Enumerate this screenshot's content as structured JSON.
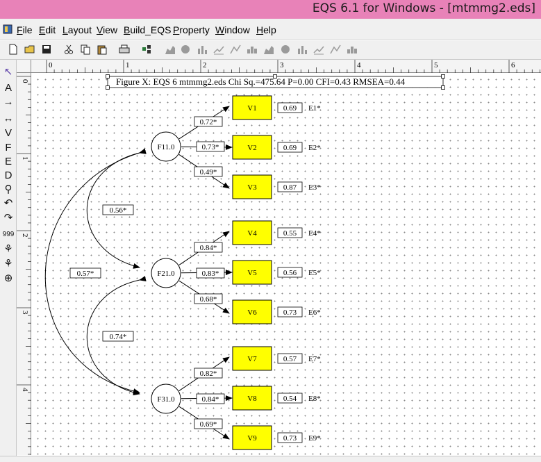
{
  "window": {
    "title": "EQS 6.1 for Windows - [mtmmg2.eds]"
  },
  "menu": [
    {
      "label": "File",
      "accel": "F",
      "rest": "ile"
    },
    {
      "label": "Edit",
      "accel": "E",
      "rest": "dit"
    },
    {
      "label": "Layout",
      "accel": "L",
      "rest": "ayout"
    },
    {
      "label": "View",
      "accel": "V",
      "rest": "iew"
    },
    {
      "label": "Build_EQS",
      "accel": "B",
      "rest": "uild_EQS"
    },
    {
      "label": "Property",
      "accel": "P",
      "rest": "roperty"
    },
    {
      "label": "Window",
      "accel": "W",
      "rest": "indow"
    },
    {
      "label": "Help",
      "accel": "H",
      "rest": "elp"
    }
  ],
  "toolbar": [
    "new-file-icon",
    "open-folder-icon",
    "save-icon",
    "cut-icon",
    "copy-icon",
    "paste-icon",
    "print-icon",
    "diagram-icon",
    "chart-bar-icon",
    "chart-line-icon",
    "chart-area-icon",
    "chart-hist-icon",
    "chart-dot-icon",
    "chart-stack-icon",
    "chart-scatter-icon",
    "chart-line2-icon",
    "chart-line3-icon",
    "chart-3d-icon",
    "chart-box-icon",
    "chart-table-icon"
  ],
  "tools": [
    {
      "name": "pointer-tool",
      "glyph": "↖"
    },
    {
      "name": "text-tool",
      "glyph": "A"
    },
    {
      "name": "one-way-arrow-tool",
      "glyph": "→"
    },
    {
      "name": "two-way-arrow-tool",
      "glyph": "↔"
    },
    {
      "name": "v-tool",
      "glyph": "V"
    },
    {
      "name": "f-tool",
      "glyph": "F"
    },
    {
      "name": "e-tool",
      "glyph": "E"
    },
    {
      "name": "d-tool",
      "glyph": "D"
    },
    {
      "name": "factor-model-tool",
      "glyph": "⚲"
    },
    {
      "name": "curve-left-tool",
      "glyph": "↶"
    },
    {
      "name": "curve-right-tool",
      "glyph": "↷"
    },
    {
      "name": "number-tool",
      "glyph": "999"
    },
    {
      "name": "structure-tool-1",
      "glyph": "⚘"
    },
    {
      "name": "structure-tool-2",
      "glyph": "⚘"
    },
    {
      "name": "crosshair-tool",
      "glyph": "⊕"
    }
  ],
  "ruler": {
    "horizontal": [
      "0",
      "1",
      "2",
      "3",
      "4",
      "5",
      "6"
    ],
    "vertical": [
      "0",
      "1",
      "2",
      "3",
      "4"
    ]
  },
  "diagram": {
    "caption": "Figure X: EQS 6 mtmmg2.eds Chi Sq.=475.64 P=0.00 CFI=0.43 RMSEA=0.44",
    "factors": [
      {
        "id": "F1",
        "label": "F11.0"
      },
      {
        "id": "F2",
        "label": "F21.0"
      },
      {
        "id": "F3",
        "label": "F31.0"
      }
    ],
    "variables": [
      {
        "label": "V1",
        "factor": "F1",
        "loading": "0.72*",
        "error_value": "0.69",
        "error_label": "E1*"
      },
      {
        "label": "V2",
        "factor": "F1",
        "loading": "0.73*",
        "error_value": "0.69",
        "error_label": "E2*"
      },
      {
        "label": "V3",
        "factor": "F1",
        "loading": "0.49*",
        "error_value": "0.87",
        "error_label": "E3*"
      },
      {
        "label": "V4",
        "factor": "F2",
        "loading": "0.84*",
        "error_value": "0.55",
        "error_label": "E4*"
      },
      {
        "label": "V5",
        "factor": "F2",
        "loading": "0.83*",
        "error_value": "0.56",
        "error_label": "E5*"
      },
      {
        "label": "V6",
        "factor": "F2",
        "loading": "0.68*",
        "error_value": "0.73",
        "error_label": "E6*"
      },
      {
        "label": "V7",
        "factor": "F3",
        "loading": "0.82*",
        "error_value": "0.57",
        "error_label": "E7*"
      },
      {
        "label": "V8",
        "factor": "F3",
        "loading": "0.84*",
        "error_value": "0.54",
        "error_label": "E8*"
      },
      {
        "label": "V9",
        "factor": "F3",
        "loading": "0.69*",
        "error_value": "0.73",
        "error_label": "E9*"
      }
    ],
    "covariances": [
      {
        "from": "F1",
        "to": "F2",
        "value": "0.56*"
      },
      {
        "from": "F2",
        "to": "F3",
        "value": "0.74*"
      },
      {
        "from": "F1",
        "to": "F3",
        "value": "0.57*"
      }
    ],
    "colors": {
      "observed_fill": "#ffff00",
      "stroke": "#000000"
    }
  }
}
